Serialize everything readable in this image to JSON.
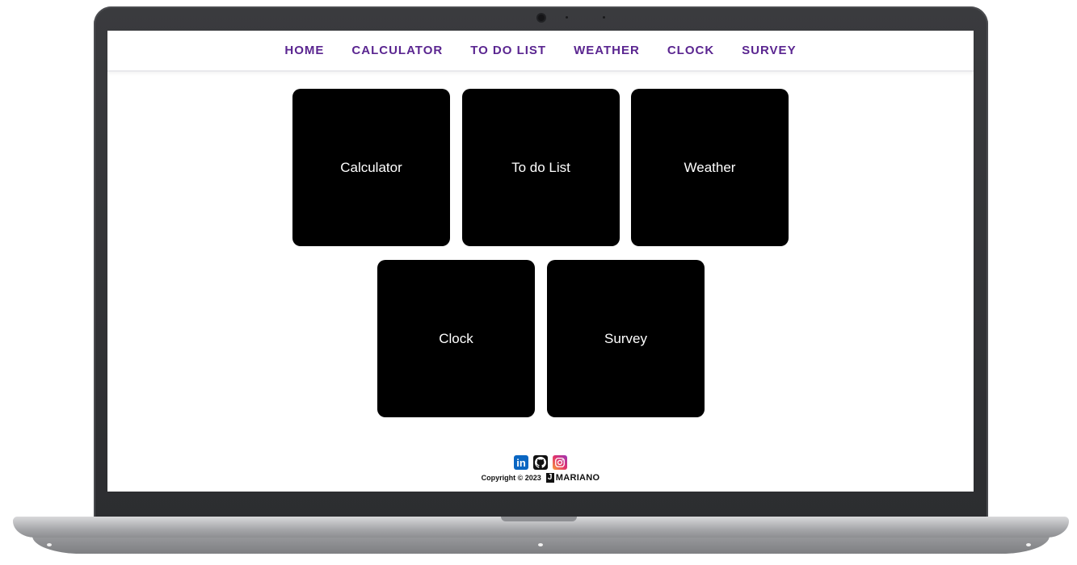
{
  "nav": {
    "items": [
      {
        "label": "HOME"
      },
      {
        "label": "CALCULATOR"
      },
      {
        "label": "TO DO LIST"
      },
      {
        "label": "WEATHER"
      },
      {
        "label": "CLOCK"
      },
      {
        "label": "SURVEY"
      }
    ]
  },
  "tiles": [
    {
      "label": "Calculator"
    },
    {
      "label": "To do List"
    },
    {
      "label": "Weather"
    },
    {
      "label": "Clock"
    },
    {
      "label": "Survey"
    }
  ],
  "footer": {
    "social": [
      "linkedin-icon",
      "github-icon",
      "instagram-icon"
    ],
    "linkedin_glyph": "in",
    "copyright": "Copyright © 2023",
    "brand_letter": "J",
    "brand_name": "MARIANO"
  },
  "colors": {
    "nav_text": "#5a2590",
    "tile_bg": "#000000",
    "tile_text": "#ffffff"
  }
}
